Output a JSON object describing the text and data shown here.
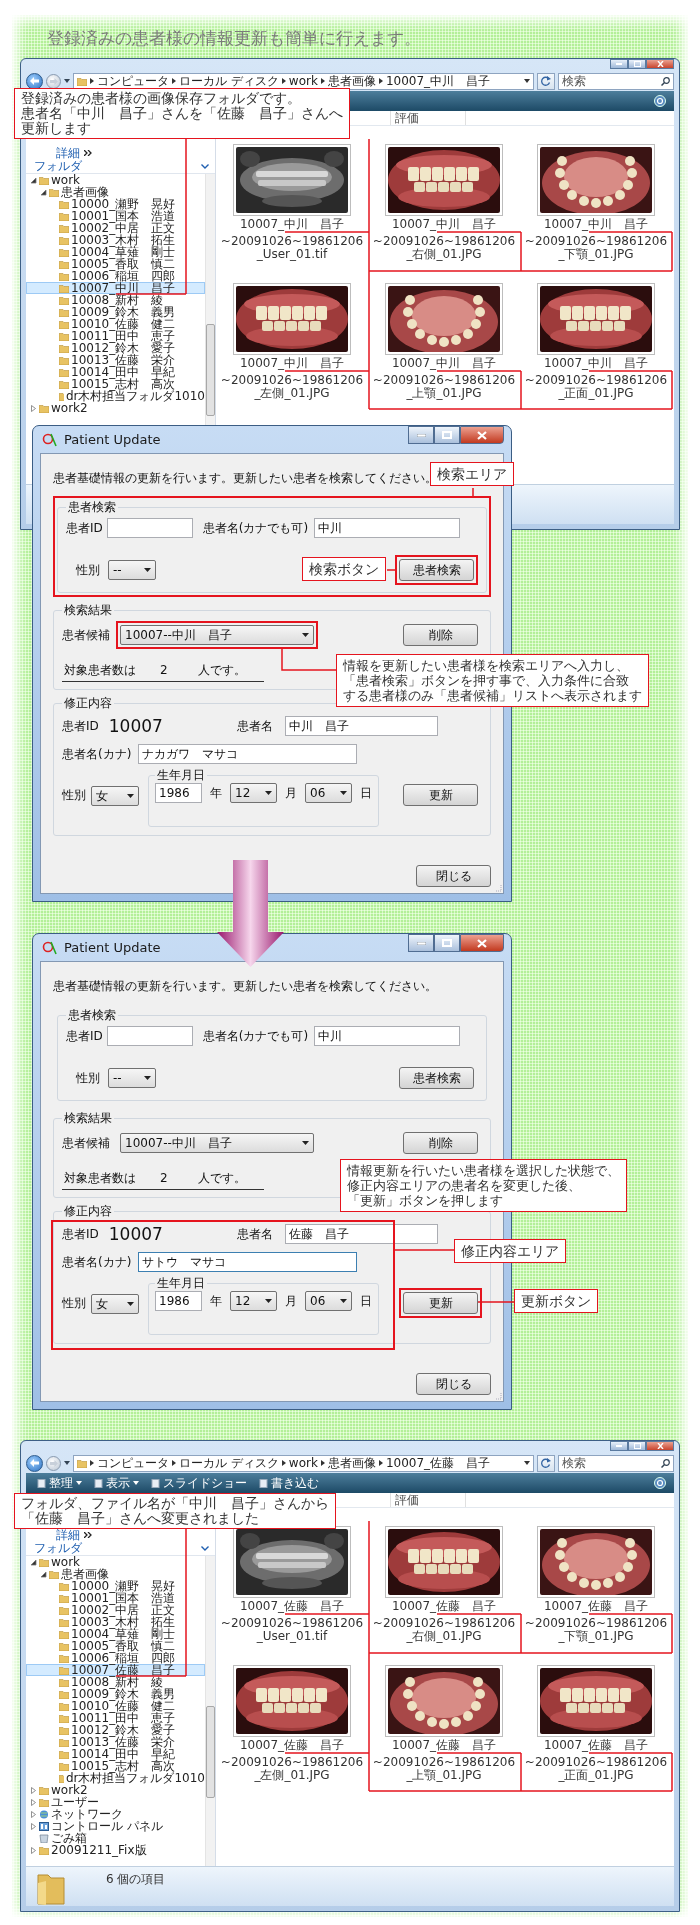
{
  "heading": "登録済みの患者様の情報更新も簡単に行えます。",
  "sections": [
    {
      "kind": "explorer",
      "breadcrumb": [
        "コンピュータ",
        "ローカル ディスク",
        "work",
        "患者画像",
        "10007_中川　昌子"
      ],
      "search": {
        "placeholder": "検索"
      },
      "callout": {
        "lines": [
          "登録済みの患者様の画像保存フォルダです。",
          "患者名「中川　昌子」さんを「佐藤　昌子」さんへ",
          "更新します"
        ]
      },
      "columns": [
        "評価"
      ],
      "details_link": "詳細",
      "folders_header": "フォルダ",
      "tree": [
        {
          "label": "work",
          "kind": "folder",
          "expanded": true,
          "selected": false,
          "children": [
            {
              "label": "患者画像",
              "expanded": true,
              "selected": false,
              "children": [
                {
                  "label": "10000_瀬野　晃好",
                  "selected": false
                },
                {
                  "label": "10001_国本　浩道",
                  "selected": false
                },
                {
                  "label": "10002_中居　正文",
                  "selected": false
                },
                {
                  "label": "10003_木村　拓生",
                  "selected": false
                },
                {
                  "label": "10004_草薙　剛士",
                  "selected": false
                },
                {
                  "label": "10005_香取　慎二",
                  "selected": false
                },
                {
                  "label": "10006_稲垣　四郎",
                  "selected": false
                },
                {
                  "label": "10007_中川　昌子",
                  "selected": true
                },
                {
                  "label": "10008_新村　綾",
                  "selected": false
                },
                {
                  "label": "10009_鈴木　義男",
                  "selected": false
                },
                {
                  "label": "10010_佐藤　健二",
                  "selected": false
                },
                {
                  "label": "10011_田中　恵子",
                  "selected": false
                },
                {
                  "label": "10012_鈴木　愛子",
                  "selected": false
                },
                {
                  "label": "10013_佐藤　栄介",
                  "selected": false
                },
                {
                  "label": "10014_田中　早紀",
                  "selected": false
                },
                {
                  "label": "10015_志村　高次",
                  "selected": false
                },
                {
                  "label": "dr木村担当フォルダ1010",
                  "selected": false
                }
              ]
            }
          ]
        },
        {
          "label": "work2",
          "kind": "folder",
          "expanded": false,
          "selected": false
        }
      ],
      "files": [
        {
          "caption_lines": [
            "10007_中川　昌子",
            "~20091026~19861206_User_01.tif"
          ]
        },
        {
          "caption_lines": [
            "10007_中川　昌子",
            "~20091026~19861206_右側_01.JPG"
          ]
        },
        {
          "caption_lines": [
            "10007_中川　昌子",
            "~20091026~19861206_下顎_01.JPG"
          ]
        },
        {
          "caption_lines": [
            "10007_中川　昌子",
            "~20091026~19861206_左側_01.JPG"
          ]
        },
        {
          "caption_lines": [
            "10007_中川　昌子",
            "~20091026~19861206_上顎_01.JPG"
          ]
        },
        {
          "caption_lines": [
            "10007_中川　昌子",
            "~20091026~19861206_正面_01.JPG"
          ]
        }
      ]
    },
    {
      "kind": "dialog",
      "title": "Patient Update",
      "description": "患者基礎情報の更新を行います。更新したい患者を検索してください。",
      "search_group": {
        "legend": "患者検索",
        "highlighted": true,
        "id_label": "患者ID",
        "name_label": "患者名(カナでも可)",
        "name_value": "中川",
        "gender_label": "性別",
        "gender_value": "--",
        "button": {
          "label": "患者検索",
          "highlighted": true
        }
      },
      "result_group": {
        "legend": "検索結果",
        "candidate_label": "患者候補",
        "candidate": {
          "value": "10007--中川　昌子",
          "highlighted": true
        },
        "delete_button": "削除",
        "count_label": "対象患者数は",
        "count": "2",
        "count_unit": "人です。"
      },
      "edit_group": {
        "legend": "修正内容",
        "highlighted": false,
        "id_label": "患者ID",
        "id_value": "10007",
        "name_label": "患者名",
        "name_value": "中川　昌子",
        "kana_label": "患者名(カナ)",
        "kana": {
          "value": "ナカガワ　マサコ",
          "focused": false
        },
        "gender_label": "性別",
        "gender_value": "女",
        "birth_legend": "生年月日",
        "year": "1986",
        "year_unit": "年",
        "month": "12",
        "month_unit": "月",
        "day": "06",
        "day_unit": "日",
        "update_button": {
          "label": "更新",
          "highlighted": false
        }
      },
      "close_button": "閉じる",
      "callouts": [
        {
          "kind": "search_area",
          "lines": [
            "検索エリア"
          ]
        },
        {
          "kind": "search_button",
          "lines": [
            "検索ボタン"
          ]
        },
        {
          "kind": "candidate_note",
          "lines": [
            "情報を更新したい患者様を検索エリアへ入力し、",
            "「患者検索」ボタンを押す事で、入力条件に合致",
            "する患者様のみ「患者候補」リストへ表示されます"
          ]
        }
      ]
    },
    {
      "kind": "dialog",
      "title": "Patient Update",
      "description": "患者基礎情報の更新を行います。更新したい患者を検索してください。",
      "search_group": {
        "legend": "患者検索",
        "highlighted": false,
        "id_label": "患者ID",
        "name_label": "患者名(カナでも可)",
        "name_value": "中川",
        "gender_label": "性別",
        "gender_value": "--",
        "button": {
          "label": "患者検索",
          "highlighted": false
        }
      },
      "result_group": {
        "legend": "検索結果",
        "candidate_label": "患者候補",
        "candidate": {
          "value": "10007--中川　昌子",
          "highlighted": false
        },
        "delete_button": "削除",
        "count_label": "対象患者数は",
        "count": "2",
        "count_unit": "人です。"
      },
      "edit_group": {
        "legend": "修正内容",
        "highlighted": true,
        "id_label": "患者ID",
        "id_value": "10007",
        "name_label": "患者名",
        "name_value": "佐藤　昌子",
        "kana_label": "患者名(カナ)",
        "kana": {
          "value": "サトウ　マサコ",
          "focused": true
        },
        "gender_label": "性別",
        "gender_value": "女",
        "birth_legend": "生年月日",
        "year": "1986",
        "year_unit": "年",
        "month": "12",
        "month_unit": "月",
        "day": "06",
        "day_unit": "日",
        "update_button": {
          "label": "更新",
          "highlighted": true
        }
      },
      "close_button": "閉じる",
      "callouts": [
        {
          "kind": "update_note",
          "lines": [
            "情報更新を行いたい患者様を選択した状態で、",
            "修正内容エリアの患者名を変更した後、",
            "「更新」ボタンを押します"
          ]
        },
        {
          "kind": "edit_area",
          "lines": [
            "修正内容エリア"
          ]
        },
        {
          "kind": "update_button",
          "lines": [
            "更新ボタン"
          ]
        }
      ]
    },
    {
      "kind": "explorer",
      "breadcrumb": [
        "コンピュータ",
        "ローカル ディスク",
        "work",
        "患者画像",
        "10007_佐藤　昌子"
      ],
      "search": {
        "placeholder": "検索"
      },
      "toolbar": [
        {
          "label": "整理",
          "dropdown": true
        },
        {
          "label": "表示",
          "dropdown": true
        },
        {
          "label": "スライドショー",
          "dropdown": false
        },
        {
          "label": "書き込む",
          "dropdown": false
        }
      ],
      "callout": {
        "lines": [
          "フォルダ、ファイル名が「中川　昌子」さんから",
          "「佐藤　昌子」さんへ変更されました"
        ]
      },
      "columns": [
        "評価"
      ],
      "details_link": "詳細",
      "folders_header": "フォルダ",
      "tree": [
        {
          "label": "work",
          "kind": "folder",
          "expanded": true,
          "selected": false,
          "children": [
            {
              "label": "患者画像",
              "expanded": true,
              "selected": false,
              "children": [
                {
                  "label": "10000_瀬野　晃好",
                  "selected": false
                },
                {
                  "label": "10001_国本　浩道",
                  "selected": false
                },
                {
                  "label": "10002_中居　正文",
                  "selected": false
                },
                {
                  "label": "10003_木村　拓生",
                  "selected": false
                },
                {
                  "label": "10004_草薙　剛士",
                  "selected": false
                },
                {
                  "label": "10005_香取　慎二",
                  "selected": false
                },
                {
                  "label": "10006_稲垣　四郎",
                  "selected": false
                },
                {
                  "label": "10007_佐藤　昌子",
                  "selected": true
                },
                {
                  "label": "10008_新村　綾",
                  "selected": false
                },
                {
                  "label": "10009_鈴木　義男",
                  "selected": false
                },
                {
                  "label": "10010_佐藤　健二",
                  "selected": false
                },
                {
                  "label": "10011_田中　恵子",
                  "selected": false
                },
                {
                  "label": "10012_鈴木　愛子",
                  "selected": false
                },
                {
                  "label": "10013_佐藤　栄介",
                  "selected": false
                },
                {
                  "label": "10014_田中　早紀",
                  "selected": false
                },
                {
                  "label": "10015_志村　高次",
                  "selected": false
                },
                {
                  "label": "dr木村担当フォルダ1010",
                  "selected": false
                }
              ]
            }
          ]
        },
        {
          "label": "work2",
          "kind": "folder",
          "expanded": false,
          "selected": false
        },
        {
          "label": "ユーザー",
          "kind": "folder",
          "expanded": false,
          "selected": false
        },
        {
          "label": "ネットワーク",
          "kind": "network",
          "expanded": false,
          "selected": false
        },
        {
          "label": "コントロール パネル",
          "kind": "control_panel",
          "expanded": false,
          "selected": false
        },
        {
          "label": "ごみ箱",
          "kind": "trash",
          "selected": false
        },
        {
          "label": "20091211_Fix版",
          "kind": "folder",
          "expanded": false,
          "selected": false
        }
      ],
      "files": [
        {
          "caption_lines": [
            "10007_佐藤　昌子",
            "~20091026~19861206_User_01.tif"
          ]
        },
        {
          "caption_lines": [
            "10007_佐藤　昌子",
            "~20091026~19861206_右側_01.JPG"
          ]
        },
        {
          "caption_lines": [
            "10007_佐藤　昌子",
            "~20091026~19861206_下顎_01.JPG"
          ]
        },
        {
          "caption_lines": [
            "10007_佐藤　昌子",
            "~20091026~19861206_左側_01.JPG"
          ]
        },
        {
          "caption_lines": [
            "10007_佐藤　昌子",
            "~20091026~19861206_上顎_01.JPG"
          ]
        },
        {
          "caption_lines": [
            "10007_佐藤　昌子",
            "~20091026~19861206_正面_01.JPG"
          ]
        }
      ],
      "status": "6 個の項目"
    }
  ]
}
